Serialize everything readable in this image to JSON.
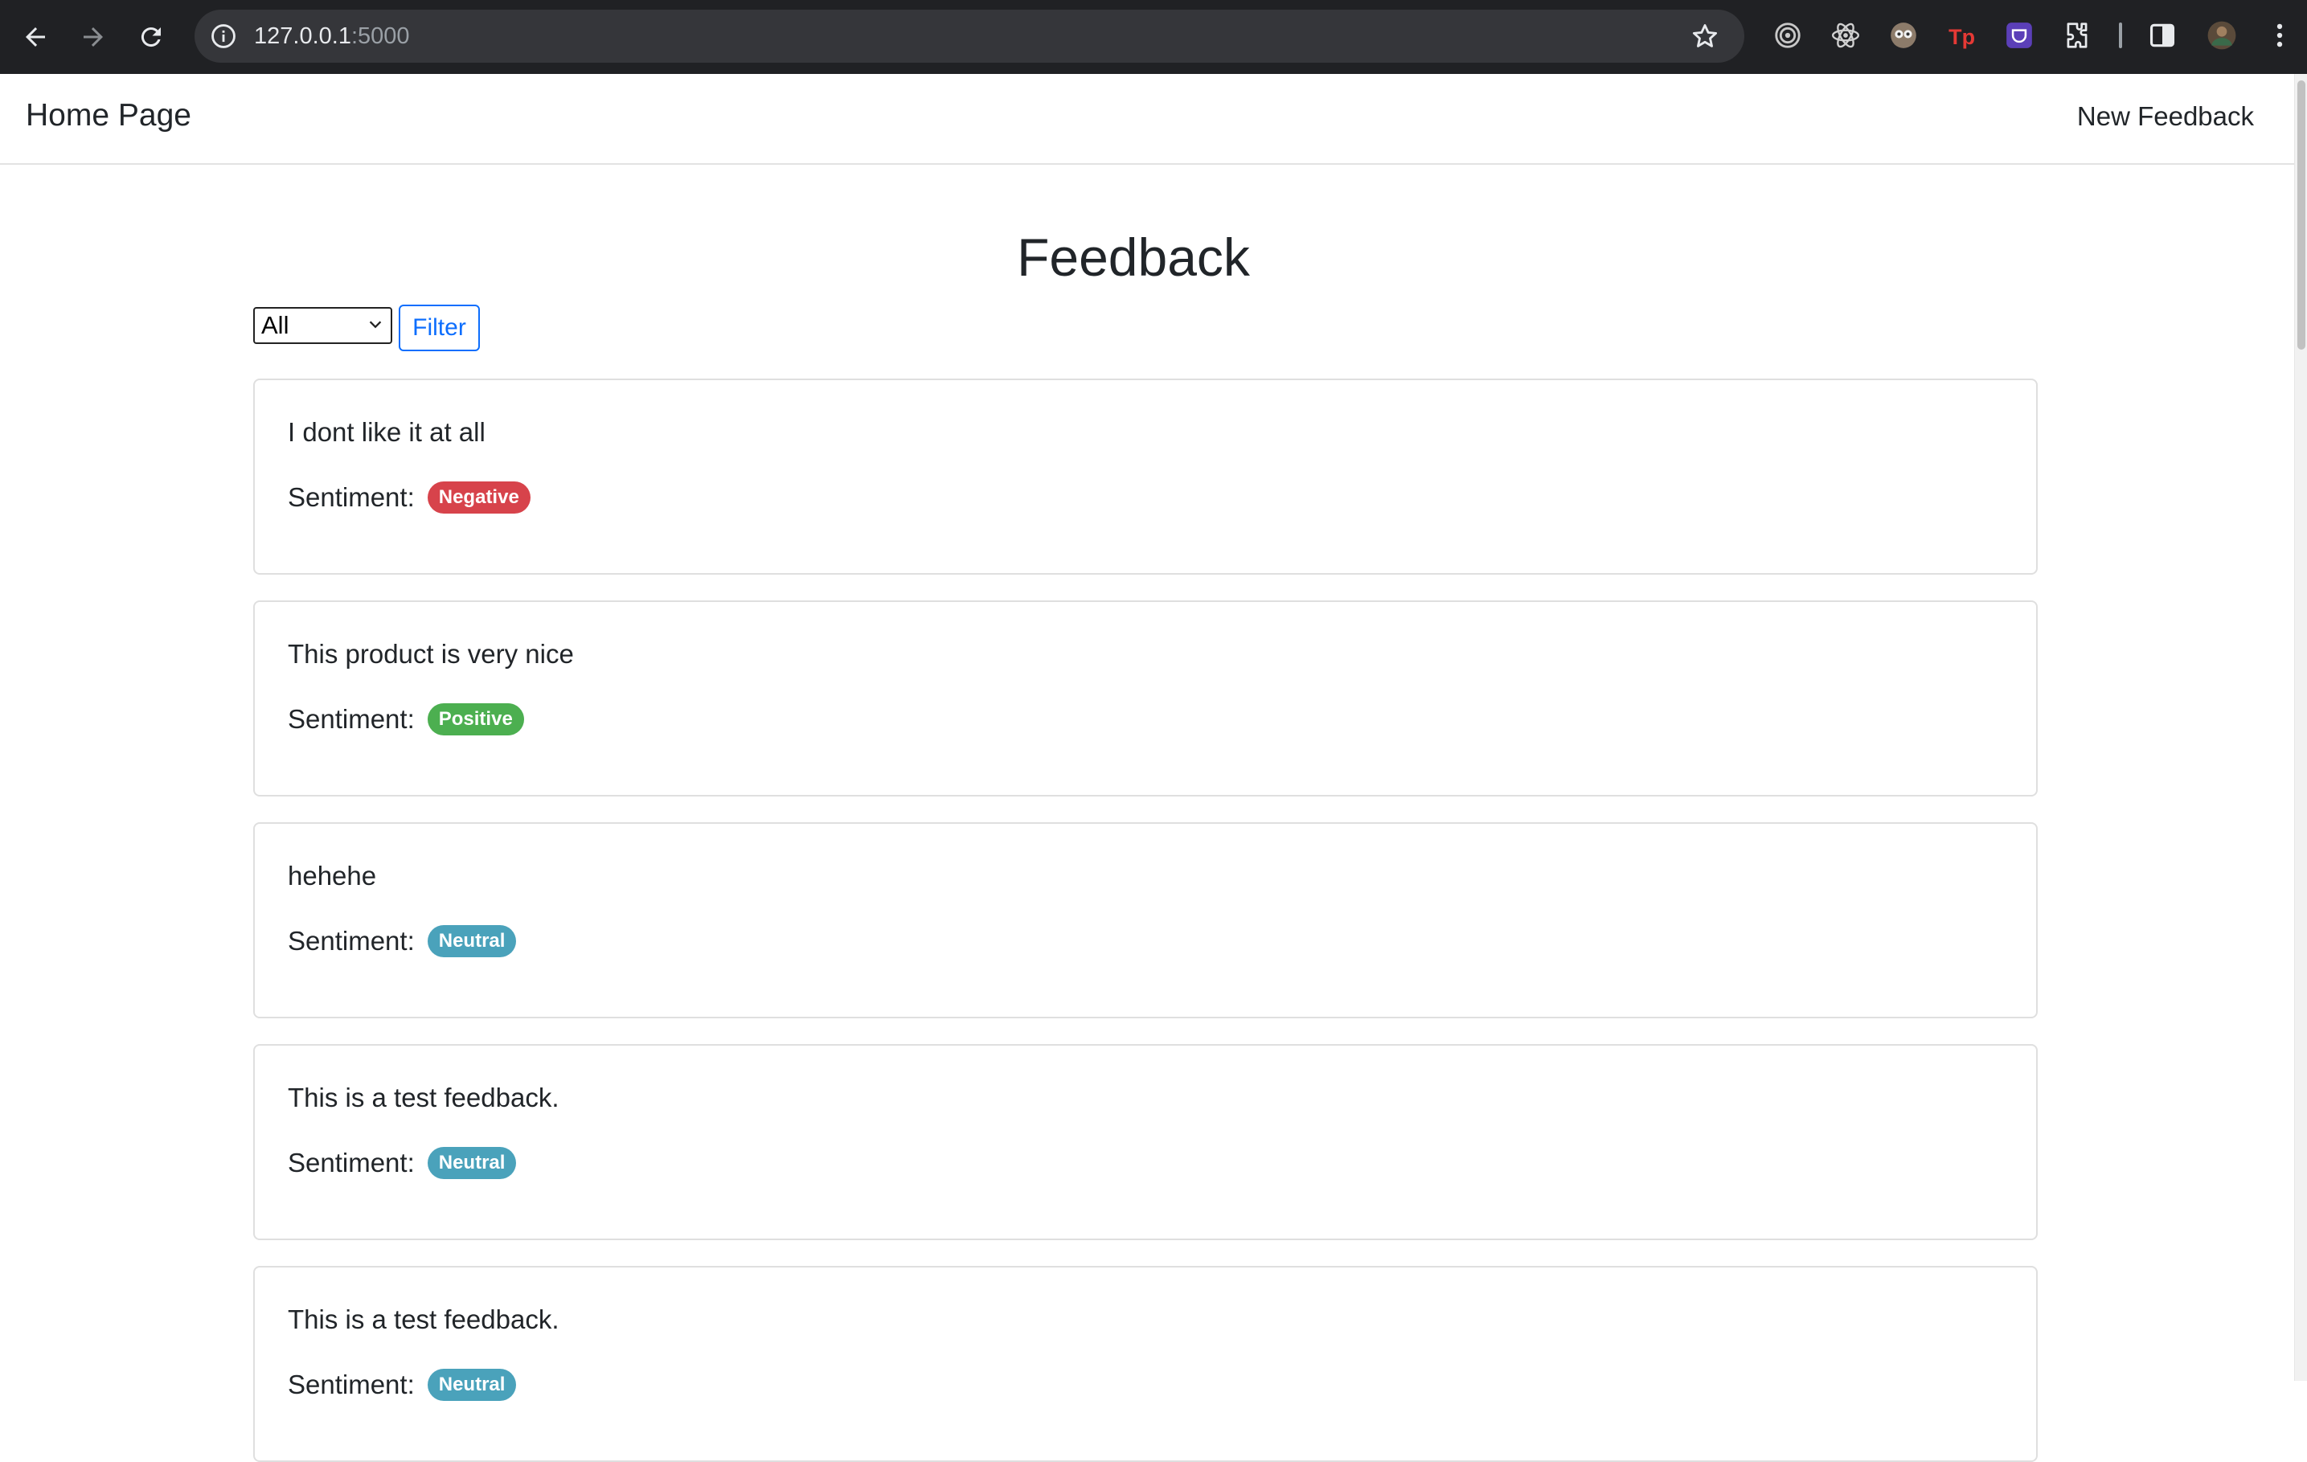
{
  "browser": {
    "url_host": "127.0.0.1",
    "url_port": ":5000"
  },
  "navbar": {
    "brand": "Home Page",
    "new_feedback": "New Feedback"
  },
  "page": {
    "title": "Feedback",
    "filter_selected": "All",
    "filter_button": "Filter"
  },
  "colors": {
    "negative": "#dc3545",
    "positive": "#28a745",
    "neutral": "#17a2b8"
  },
  "feedback": [
    {
      "text": "I dont like it at all",
      "label": "Sentiment:",
      "sentiment": "Negative",
      "color": "#d7434b"
    },
    {
      "text": "This product is very nice",
      "label": "Sentiment:",
      "sentiment": "Positive",
      "color": "#4caf50"
    },
    {
      "text": "hehehe",
      "label": "Sentiment:",
      "sentiment": "Neutral",
      "color": "#4aa2bb"
    },
    {
      "text": "This is a test feedback.",
      "label": "Sentiment:",
      "sentiment": "Neutral",
      "color": "#4aa2bb"
    },
    {
      "text": "This is a test feedback.",
      "label": "Sentiment:",
      "sentiment": "Neutral",
      "color": "#4aa2bb"
    }
  ]
}
